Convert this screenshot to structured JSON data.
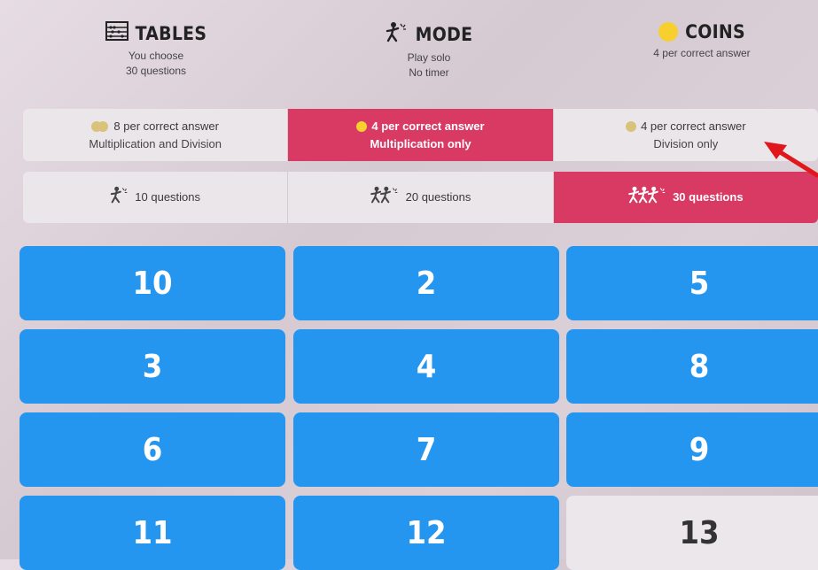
{
  "stats": [
    {
      "title": "TABLES",
      "icon": "abacus-icon",
      "line1": "You choose",
      "line2": "30 questions"
    },
    {
      "title": "MODE",
      "icon": "fighter-icon",
      "line1": "Play solo",
      "line2": "No timer"
    },
    {
      "title": "COINS",
      "icon": "coin-icon",
      "line1": "4 per correct answer",
      "line2": ""
    }
  ],
  "operations": [
    {
      "line1": "8 per correct answer",
      "line2": "Multiplication and Division",
      "selected": false
    },
    {
      "line1": "4 per correct answer",
      "line2": "Multiplication only",
      "selected": true
    },
    {
      "line1": "4 per correct answer",
      "line2": "Division only",
      "selected": false
    }
  ],
  "questions": [
    {
      "label": "10 questions",
      "selected": false
    },
    {
      "label": "20 questions",
      "selected": false
    },
    {
      "label": "30 questions",
      "selected": true
    }
  ],
  "tables": [
    "10",
    "2",
    "5",
    "3",
    "4",
    "8",
    "6",
    "7",
    "9",
    "11",
    "12",
    "13"
  ],
  "colors": {
    "accent": "#d83a63",
    "tile": "#2596f0",
    "tile_off": "#ebe7ea",
    "arrow": "#e0181b"
  }
}
